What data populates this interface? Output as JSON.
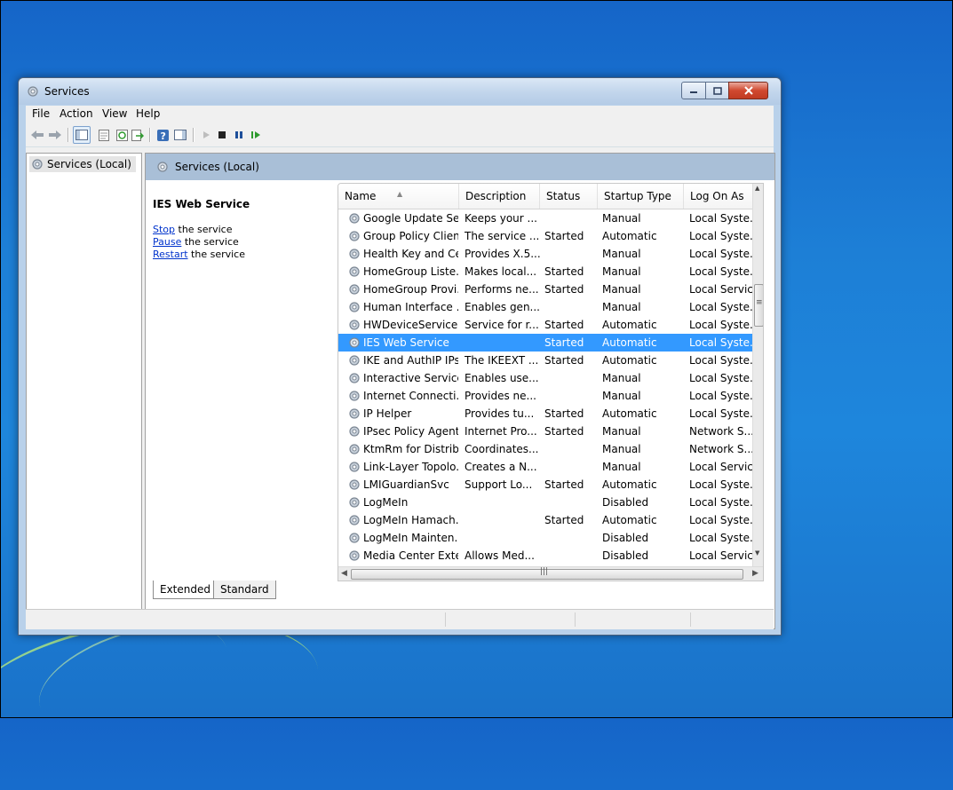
{
  "window": {
    "title": "Services",
    "controls": {
      "minimize": "minimize",
      "maximize": "maximize",
      "close": "close"
    }
  },
  "menu": [
    "File",
    "Action",
    "View",
    "Help"
  ],
  "toolbar": {
    "icons": [
      "back-arrow-icon",
      "forward-arrow-icon",
      "console-tree-icon",
      "properties-icon",
      "refresh-icon",
      "export-list-icon",
      "help-icon",
      "show-hide-action-pane-icon",
      "start-service-icon",
      "stop-service-icon",
      "pause-service-icon",
      "resume-service-icon"
    ]
  },
  "tree": {
    "root": "Services (Local)"
  },
  "details": {
    "header": "Services (Local)",
    "selected_service": "IES Web Service",
    "actions": [
      {
        "link": "Stop",
        "rest": " the service"
      },
      {
        "link": "Pause",
        "rest": " the service"
      },
      {
        "link": "Restart",
        "rest": " the service"
      }
    ]
  },
  "list": {
    "columns": [
      "Name",
      "Description",
      "Status",
      "Startup Type",
      "Log On As"
    ],
    "rows": [
      {
        "name": "Google Update Se...",
        "desc": "Keeps your ...",
        "status": "",
        "startup": "Manual",
        "logon": "Local Syste..."
      },
      {
        "name": "Group Policy Client",
        "desc": "The service ...",
        "status": "Started",
        "startup": "Automatic",
        "logon": "Local Syste..."
      },
      {
        "name": "Health Key and Ce...",
        "desc": "Provides X.5...",
        "status": "",
        "startup": "Manual",
        "logon": "Local Syste..."
      },
      {
        "name": "HomeGroup Liste...",
        "desc": "Makes local...",
        "status": "Started",
        "startup": "Manual",
        "logon": "Local Syste..."
      },
      {
        "name": "HomeGroup Provi...",
        "desc": "Performs ne...",
        "status": "Started",
        "startup": "Manual",
        "logon": "Local Service"
      },
      {
        "name": "Human Interface ...",
        "desc": "Enables gen...",
        "status": "",
        "startup": "Manual",
        "logon": "Local Syste..."
      },
      {
        "name": "HWDeviceService....",
        "desc": "Service for r...",
        "status": "Started",
        "startup": "Automatic",
        "logon": "Local Syste..."
      },
      {
        "name": "IES Web Service",
        "desc": "",
        "status": "Started",
        "startup": "Automatic",
        "logon": "Local Syste...",
        "selected": true
      },
      {
        "name": "IKE and AuthIP IPs...",
        "desc": "The IKEEXT ...",
        "status": "Started",
        "startup": "Automatic",
        "logon": "Local Syste..."
      },
      {
        "name": "Interactive Service...",
        "desc": "Enables use...",
        "status": "",
        "startup": "Manual",
        "logon": "Local Syste..."
      },
      {
        "name": "Internet Connecti...",
        "desc": "Provides ne...",
        "status": "",
        "startup": "Manual",
        "logon": "Local Syste..."
      },
      {
        "name": "IP Helper",
        "desc": "Provides tu...",
        "status": "Started",
        "startup": "Automatic",
        "logon": "Local Syste..."
      },
      {
        "name": "IPsec Policy Agent",
        "desc": "Internet Pro...",
        "status": "Started",
        "startup": "Manual",
        "logon": "Network S..."
      },
      {
        "name": "KtmRm for Distrib...",
        "desc": "Coordinates...",
        "status": "",
        "startup": "Manual",
        "logon": "Network S..."
      },
      {
        "name": "Link-Layer Topolo...",
        "desc": "Creates a N...",
        "status": "",
        "startup": "Manual",
        "logon": "Local Service"
      },
      {
        "name": "LMIGuardianSvc",
        "desc": "Support Lo...",
        "status": "Started",
        "startup": "Automatic",
        "logon": "Local Syste..."
      },
      {
        "name": "LogMeIn",
        "desc": "",
        "status": "",
        "startup": "Disabled",
        "logon": "Local Syste..."
      },
      {
        "name": "LogMeIn Hamach...",
        "desc": "",
        "status": "Started",
        "startup": "Automatic",
        "logon": "Local Syste..."
      },
      {
        "name": "LogMeIn Mainten...",
        "desc": "",
        "status": "",
        "startup": "Disabled",
        "logon": "Local Syste..."
      },
      {
        "name": "Media Center Exte...",
        "desc": "Allows Med...",
        "status": "",
        "startup": "Disabled",
        "logon": "Local Service"
      }
    ]
  },
  "tabs": [
    "Extended",
    "Standard"
  ],
  "colors": {
    "selection": "#3399ff",
    "header_band": "#a9bfd7",
    "frame": "#b9d1ea",
    "link": "#0033cc"
  }
}
